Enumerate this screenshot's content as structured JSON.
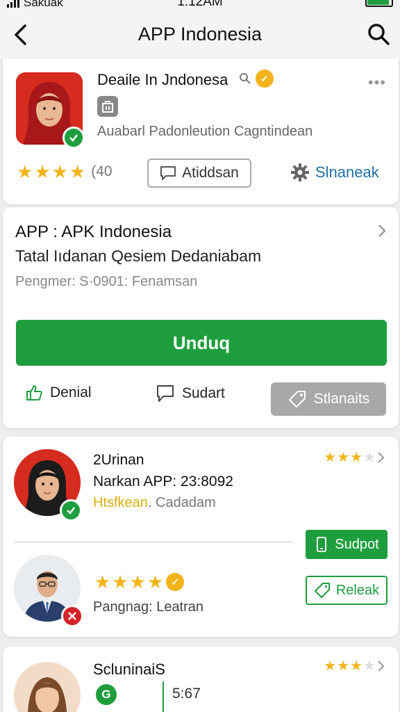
{
  "status_bar": {
    "carrier": "Sakuak",
    "time": "1:12AM",
    "battery_percent": 90
  },
  "header": {
    "title": "APP Indonesia"
  },
  "app_card": {
    "name": "Deaile In Jndonesa",
    "subtitle": "Auabarl Padonleution Cagntindean",
    "rating_stars": 4,
    "rating_count": "(40",
    "button_label": "Atiddsan",
    "link_label": "Slnaneak"
  },
  "detail_card": {
    "title": "APP : APK Indonesia",
    "subtitle": "Tatal Iıdanan Qesiem Dedaniabam",
    "meta": "Pengmer: S·0901: Fenamsan",
    "download_label": "Unduq",
    "like_label": "Denial",
    "comment_label": "Sudart",
    "share_label": "Stlanaits"
  },
  "review_card": {
    "review1": {
      "name": "2Urinan",
      "line2": "Narkan APP: 23:8092",
      "highlight": "Htsfkean",
      "rest": ". Cadadam",
      "stars": 3
    },
    "support_label": "Sudpot",
    "review2": {
      "stars": 4,
      "line": "Pangnag: Leatran"
    },
    "release_label": "Releak"
  },
  "review_card2": {
    "name": "ScluninaiS",
    "stars": 3,
    "time": "5:67",
    "badge": "G"
  },
  "colors": {
    "green": "#1e9e3e",
    "star": "#f3b41b",
    "red": "#d62b1f",
    "link": "#1f6fa6"
  }
}
